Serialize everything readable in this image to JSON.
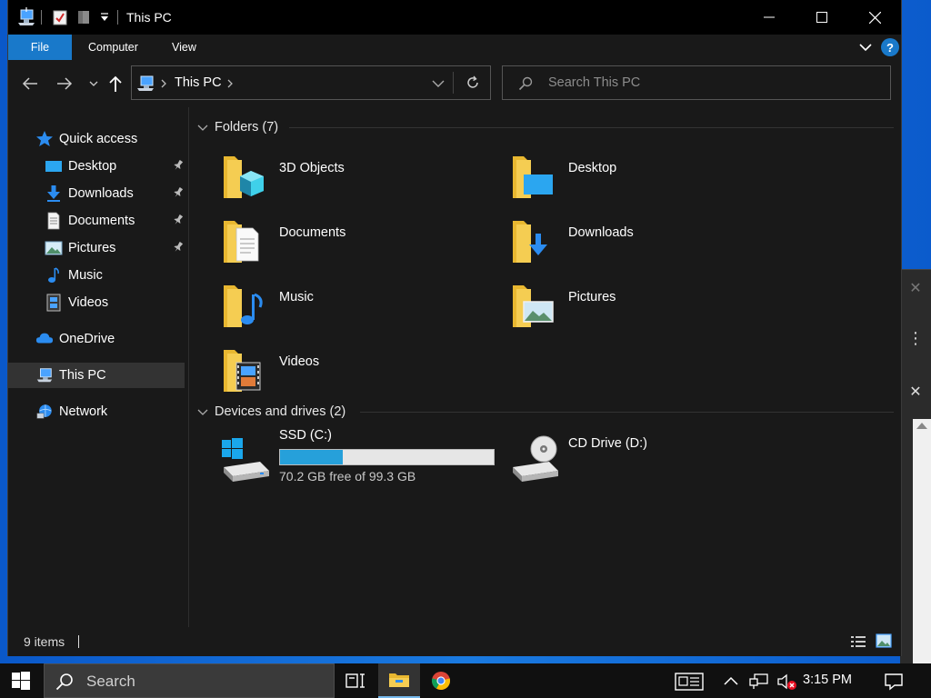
{
  "window": {
    "title": "This PC",
    "caption": {
      "minimize": "—",
      "maximize": "☐",
      "close": "✕"
    }
  },
  "ribbon": {
    "tabs": [
      "File",
      "Computer",
      "View"
    ],
    "help": "?"
  },
  "address": {
    "path": "This PC",
    "search_placeholder": "Search This PC"
  },
  "nav": {
    "quick_access": "Quick access",
    "pinned": [
      "Desktop",
      "Downloads",
      "Documents",
      "Pictures"
    ],
    "unpinned": [
      "Music",
      "Videos"
    ],
    "onedrive": "OneDrive",
    "this_pc": "This PC",
    "network": "Network"
  },
  "content": {
    "folders_header": "Folders (7)",
    "folders": [
      "3D Objects",
      "Desktop",
      "Documents",
      "Downloads",
      "Music",
      "Pictures",
      "Videos"
    ],
    "drives_header": "Devices and drives (2)",
    "drives": [
      {
        "name": "SSD (C:)",
        "free_text": "70.2 GB free of 99.3 GB",
        "used_fraction": 0.293
      },
      {
        "name": "CD Drive (D:)"
      }
    ]
  },
  "status": {
    "item_count": "9 items"
  },
  "taskbar": {
    "search_placeholder": "Search",
    "clock": "3:15 PM"
  },
  "colors": {
    "accent": "#1979ca",
    "drive_fill": "#26a0da",
    "folder_yellow": "#f5c842",
    "background": "#191919"
  }
}
